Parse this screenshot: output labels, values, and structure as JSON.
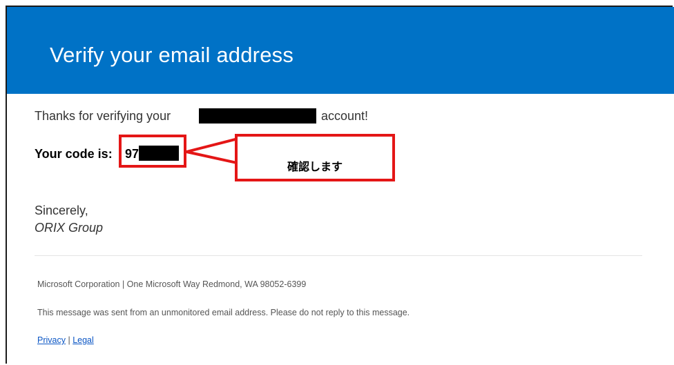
{
  "header": {
    "title": "Verify your email address"
  },
  "body": {
    "thanks_prefix": "Thanks for verifying your",
    "thanks_suffix": "account!",
    "code_label": "Your code is:",
    "code_visible": "97",
    "sincerely": "Sincerely,",
    "signature": "ORIX Group"
  },
  "annotation": {
    "callout_text": "確認します"
  },
  "footer": {
    "address": "Microsoft Corporation | One Microsoft Way Redmond, WA 98052-6399",
    "notice": "This message was sent from an unmonitored email address. Please do not reply to this message.",
    "privacy_link": "Privacy",
    "separator": "|",
    "legal_link": "Legal"
  },
  "colors": {
    "header_bg": "#0072c6",
    "annotation_red": "#e41616",
    "link_blue": "#0a55c4"
  }
}
